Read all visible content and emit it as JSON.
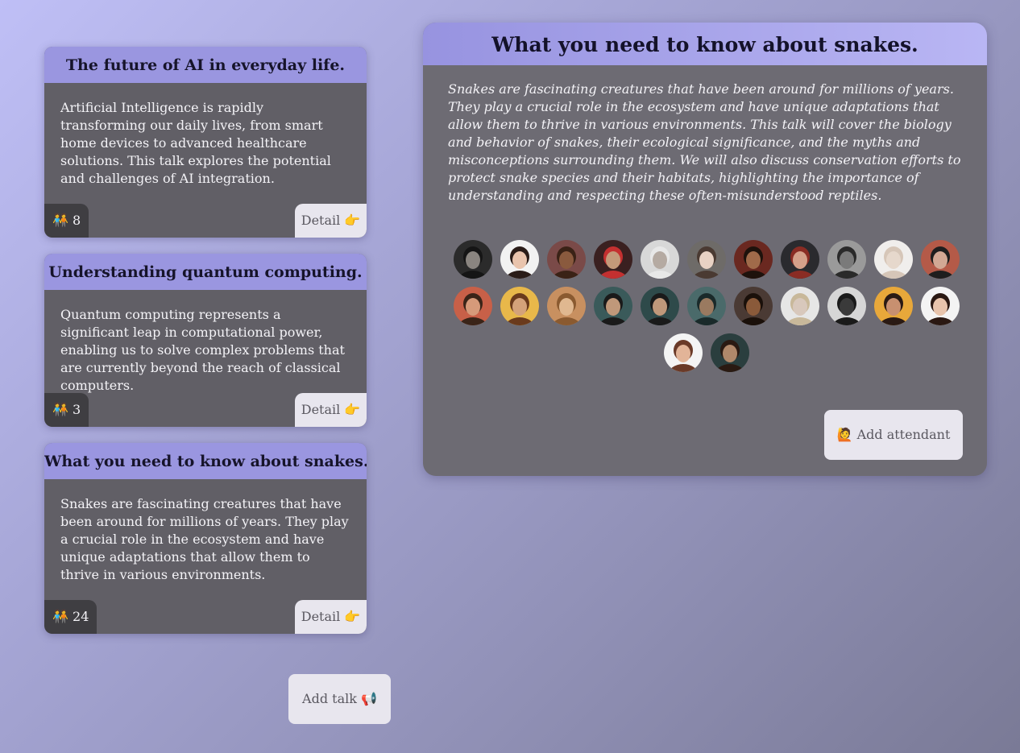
{
  "talks": [
    {
      "title": "The future of AI in everyday life.",
      "description": "Artificial Intelligence is rapidly transforming our daily lives, from smart home devices to advanced healthcare solutions. This talk explores the potential and challenges of AI integration.",
      "attendees_label": "🧑‍🤝‍🧑 8",
      "detail_label": "Detail 👉"
    },
    {
      "title": "Understanding quantum computing.",
      "description": "Quantum computing represents a significant leap in computational power, enabling us to solve complex problems that are currently beyond the reach of classical computers.",
      "attendees_label": "🧑‍🤝‍🧑 3",
      "detail_label": "Detail 👉"
    },
    {
      "title": "What you need to know about snakes.",
      "description": "Snakes are fascinating creatures that have been around for millions of years. They play a crucial role in the ecosystem and have unique adaptations that allow them to thrive in various environments.",
      "attendees_label": "🧑‍🤝‍🧑 24",
      "detail_label": "Detail 👉"
    }
  ],
  "add_talk_label": "Add talk 📢",
  "detail": {
    "title": "What you need to know about snakes.",
    "description": "Snakes are fascinating creatures that have been around for millions of years. They play a crucial role in the ecosystem and have unique adaptations that allow them to thrive in various environments. This talk will cover the biology and behavior of snakes, their ecological significance, and the myths and misconceptions surrounding them. We will also discuss conservation efforts to protect snake species and their habitats, highlighting the importance of understanding and respecting these often-misunderstood reptiles.",
    "add_attendant_label": "🙋 Add attendant",
    "attendees": [
      {
        "icon": "avatar-photo",
        "bg": "#2b2b2b",
        "skin": "#8a8580",
        "hair": "#151515"
      },
      {
        "icon": "avatar-photo",
        "bg": "#f2f2f2",
        "skin": "#e9c4ad",
        "hair": "#2a1c18"
      },
      {
        "icon": "avatar-photo",
        "bg": "#7a4a48",
        "skin": "#8a5a3e",
        "hair": "#3a2216"
      },
      {
        "icon": "avatar-photo",
        "bg": "#3a2020",
        "skin": "#c49a7a",
        "hair": "#c43030"
      },
      {
        "icon": "avatar-photo",
        "bg": "#d8d8d8",
        "skin": "#b5aaa2",
        "hair": "#e8e8e8"
      },
      {
        "icon": "avatar-photo",
        "bg": "#6e6b68",
        "skin": "#e8d2c4",
        "hair": "#4a3a32"
      },
      {
        "icon": "avatar-photo",
        "bg": "#6a2820",
        "skin": "#a06a4a",
        "hair": "#1e120c"
      },
      {
        "icon": "avatar-photo",
        "bg": "#2a2a2e",
        "skin": "#d4a08a",
        "hair": "#8a2c24"
      },
      {
        "icon": "avatar-photo",
        "bg": "#9a9a9a",
        "skin": "#7a7a7a",
        "hair": "#2a2a2a"
      },
      {
        "icon": "avatar-photo",
        "bg": "#f0eeec",
        "skin": "#e6d8cc",
        "hair": "#d6c6b8"
      },
      {
        "icon": "avatar-photo",
        "bg": "#b45a48",
        "skin": "#d2a894",
        "hair": "#1e1e1e"
      },
      {
        "icon": "avatar-photo",
        "bg": "#c86048",
        "skin": "#d69a7a",
        "hair": "#3a2418"
      },
      {
        "icon": "avatar-photo",
        "bg": "#e8b84a",
        "skin": "#d4a27a",
        "hair": "#6a3a1c"
      },
      {
        "icon": "avatar-photo",
        "bg": "#c89060",
        "skin": "#e0b890",
        "hair": "#8a5a30"
      },
      {
        "icon": "avatar-photo",
        "bg": "#3a5a5a",
        "skin": "#c0987a",
        "hair": "#1a1a1a"
      },
      {
        "icon": "avatar-photo",
        "bg": "#2e4a4a",
        "skin": "#c0987a",
        "hair": "#1a1a1a"
      },
      {
        "icon": "avatar-photo",
        "bg": "#4a6a6a",
        "skin": "#9a7a60",
        "hair": "#1a2a2a"
      },
      {
        "icon": "avatar-photo",
        "bg": "#4a3a34",
        "skin": "#8a5a3a",
        "hair": "#1a100a"
      },
      {
        "icon": "avatar-photo",
        "bg": "#e6e6e6",
        "skin": "#d8c8bc",
        "hair": "#c8b89a"
      },
      {
        "icon": "avatar-photo",
        "bg": "#d6d6d6",
        "skin": "#3a3a3a",
        "hair": "#1a1a1a"
      },
      {
        "icon": "avatar-photo",
        "bg": "#e8a83a",
        "skin": "#c89070",
        "hair": "#2a1a14"
      },
      {
        "icon": "avatar-photo",
        "bg": "#f4f4f4",
        "skin": "#e8c4ac",
        "hair": "#2a1812"
      },
      {
        "icon": "avatar-photo",
        "bg": "#f4f4f4",
        "skin": "#e2b498",
        "hair": "#6a3a28"
      },
      {
        "icon": "avatar-photo",
        "bg": "#2a3e3e",
        "skin": "#b0886a",
        "hair": "#2a1a12"
      }
    ]
  },
  "colors": {
    "card_header": "#9a96e0",
    "card_body": "#615f66",
    "panel_body": "#6d6b73",
    "button_bg": "#e8e6ee"
  }
}
